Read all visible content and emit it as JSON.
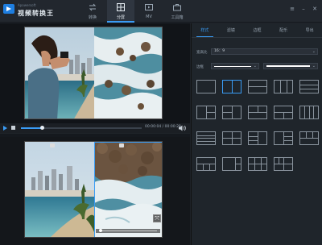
{
  "app": {
    "subtitle": "Apowersoft",
    "title": "视频转换王"
  },
  "nav": {
    "tabs": [
      {
        "label": "转换",
        "icon": "convert-icon"
      },
      {
        "label": "分屏",
        "icon": "split-screen-icon",
        "active": true
      },
      {
        "label": "MV",
        "icon": "mv-icon"
      },
      {
        "label": "工具箱",
        "icon": "toolbox-icon"
      }
    ]
  },
  "player": {
    "timecode": "00:00:04 / 00:00:28",
    "progress": 0.17
  },
  "editor": {
    "left_cell_icon": "video-icon",
    "right_cell_icon": "video-icon",
    "crop_icon": "crop-icon"
  },
  "sidebar": {
    "tabs": [
      "样式",
      "滤镜",
      "边框",
      "配乐",
      "导出"
    ],
    "active_tab": 0,
    "aspect_label": "宽高比",
    "aspect_value": "16：9",
    "border_label": "边框",
    "border_color": "#ffffff",
    "accent": "#3a9cf5"
  },
  "layouts": {
    "count": 19,
    "selected_index": 1
  }
}
